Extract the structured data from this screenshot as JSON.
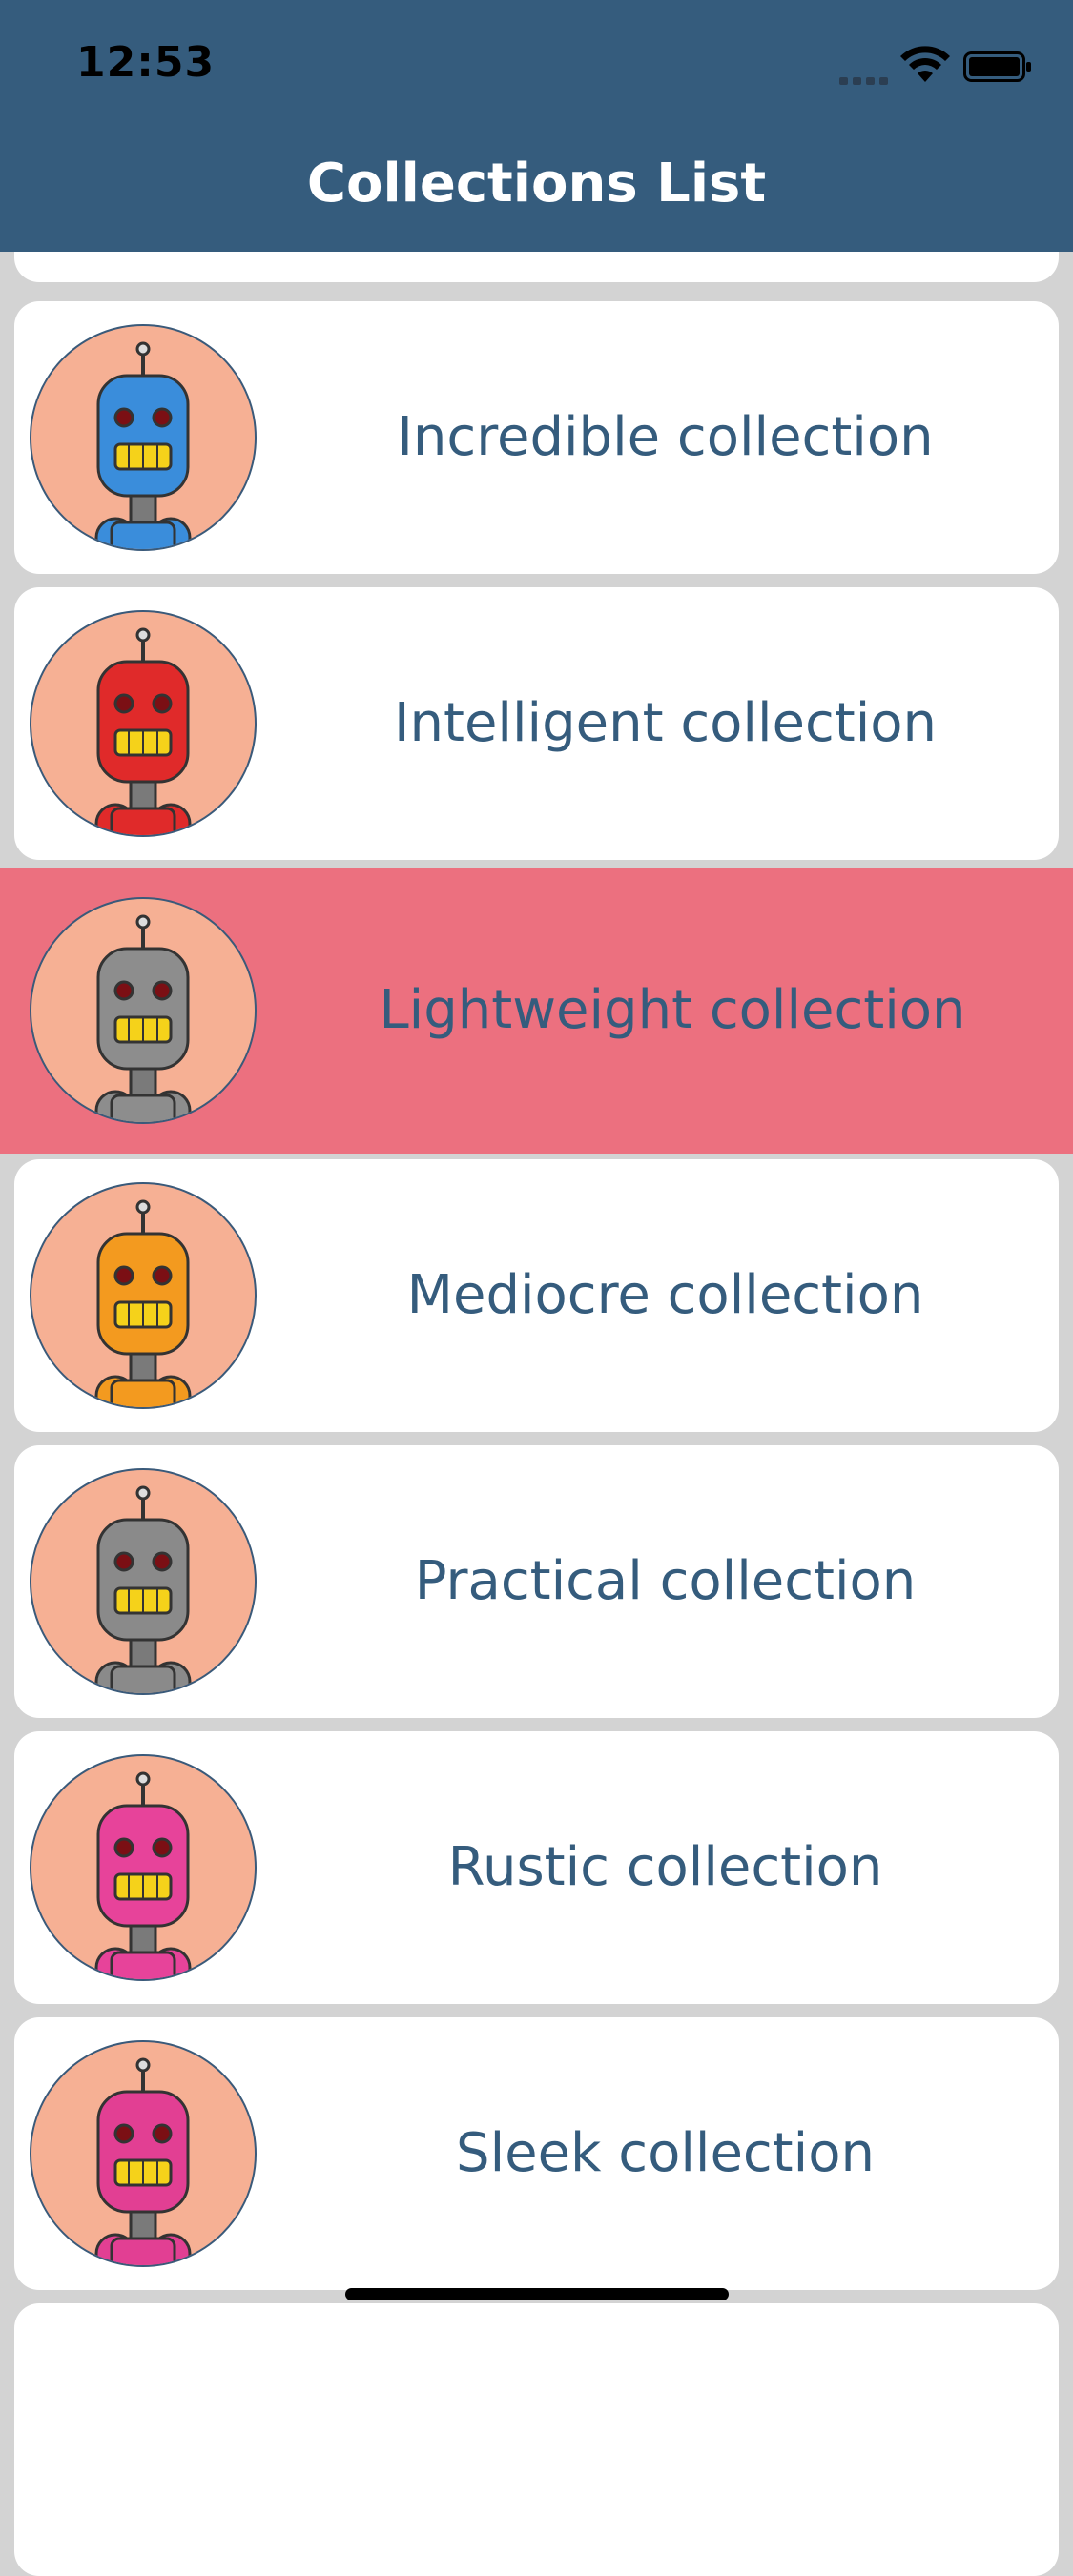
{
  "status_bar": {
    "time": "12:53"
  },
  "header": {
    "title": "Collections List"
  },
  "list": {
    "items": [
      {
        "label": "",
        "robot_color": "#e53935",
        "icon": "robot-avatar-icon"
      },
      {
        "label": "Incredible collection",
        "robot_color": "#3a8ddb",
        "icon": "robot-avatar-icon"
      },
      {
        "label": "Intelligent collection",
        "robot_color": "#e02a2a",
        "icon": "robot-avatar-icon"
      },
      {
        "label": "Lightweight collection",
        "robot_color": "#8d8d8d",
        "icon": "robot-avatar-icon",
        "selected": true
      },
      {
        "label": "Mediocre collection",
        "robot_color": "#f39a1f",
        "icon": "robot-avatar-icon"
      },
      {
        "label": "Practical collection",
        "robot_color": "#8a8a8a",
        "icon": "robot-avatar-icon"
      },
      {
        "label": "Rustic collection",
        "robot_color": "#e7439a",
        "icon": "robot-avatar-icon"
      },
      {
        "label": "Sleek collection",
        "robot_color": "#e23f93",
        "icon": "robot-avatar-icon"
      },
      {
        "label": "",
        "robot_color": "#999999",
        "icon": "robot-avatar-icon"
      }
    ]
  },
  "colors": {
    "header_bg": "#355c7d",
    "list_bg": "#d3d3d3",
    "card_bg": "#ffffff",
    "selected_bg": "#ec707f",
    "label_color": "#355c7d",
    "avatar_bg": "#f6b094"
  }
}
